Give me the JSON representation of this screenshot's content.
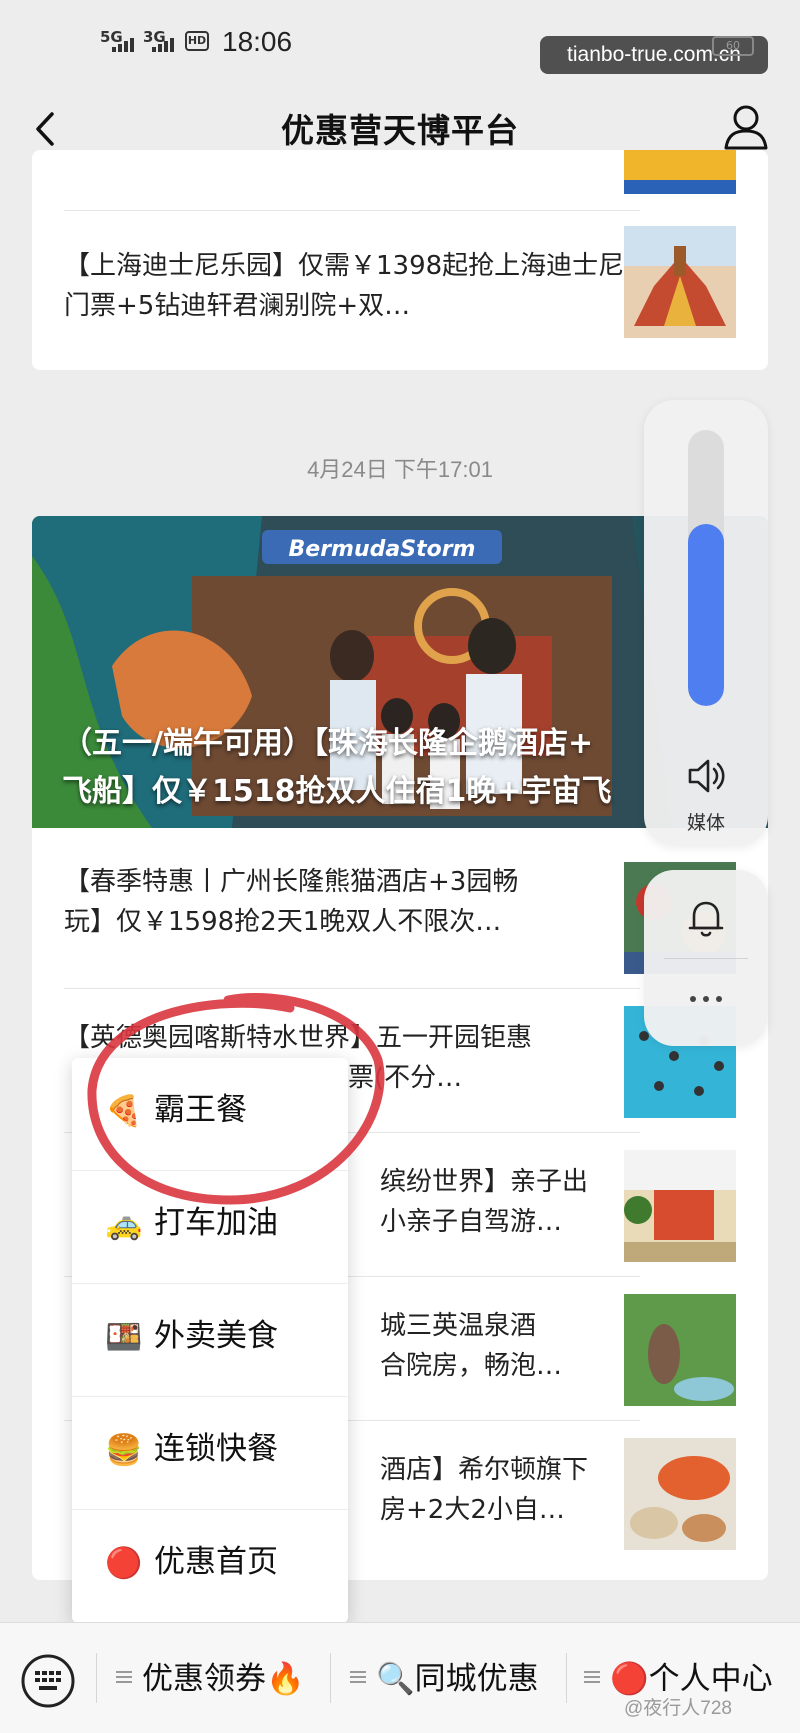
{
  "status_bar": {
    "signal_1": "5G",
    "signal_2": "3G",
    "hd_badge": "HD",
    "time": "18:06",
    "domain_watermark": "tianbo-true.com.cn",
    "battery": "60"
  },
  "header": {
    "title": "优惠营天博平台",
    "back_icon": "chevron-left-icon",
    "profile_icon": "person-icon"
  },
  "feed": {
    "top_card": {
      "items": [
        {
          "text": "【上海迪士尼乐园】仅需￥1398起抢上海迪士尼门票+5钻迪轩君澜别院+双…"
        }
      ]
    },
    "timestamp": "4月24日 下午17:01",
    "hero": {
      "title": "（五一/端午可用）【珠海长隆企鹅酒店+飞船】仅￥1518抢双人住宿1晚+宇宙飞船",
      "title_line1": "（五一/端午可用）【珠海长隆企鹅酒店+",
      "title_line2": "飞船】仅￥1518抢双人住宿1晚+宇宙飞",
      "sign_text": "BermudaStorm"
    },
    "items": [
      {
        "line1": "【春季特惠丨广州长隆熊猫酒店+3园畅",
        "line2": "玩】仅￥1598抢2天1晚双人不限次…"
      },
      {
        "line1": "【英德奥园喀斯特水世界】五一开园钜惠",
        "line2": "双人票(不分…"
      },
      {
        "line1": "缤纷世界】亲子出",
        "line2": "小亲子自驾游…"
      },
      {
        "line1": "城三英温泉酒",
        "line2": "合院房，畅泡…"
      },
      {
        "line1": "酒店】希尔顿旗下",
        "line2": "房+2大2小自…"
      }
    ]
  },
  "volume_panel": {
    "level": 0.66,
    "label": "媒体",
    "speaker_icon": "speaker-icon",
    "bell_icon": "bell-icon",
    "more_icon": "more-dots-icon"
  },
  "popup_menu": {
    "items": [
      {
        "emoji": "🍕",
        "label": "霸王餐"
      },
      {
        "emoji": "🚕",
        "label": "打车加油"
      },
      {
        "emoji": "🍱",
        "label": "外卖美食"
      },
      {
        "emoji": "🍔",
        "label": "连锁快餐"
      },
      {
        "emoji": "🔴",
        "label": "优惠首页"
      }
    ]
  },
  "bottom_bar": {
    "keyboard_icon": "keyboard-icon",
    "tabs": [
      {
        "label": "优惠领券🔥"
      },
      {
        "label": "🔍同城优惠"
      },
      {
        "label": "🔴个人中心"
      }
    ],
    "corner_watermark": "@夜行人728"
  },
  "colors": {
    "accent_blue": "#4e7ef0",
    "annotation_red": "#d9363e",
    "background": "#ededed"
  }
}
